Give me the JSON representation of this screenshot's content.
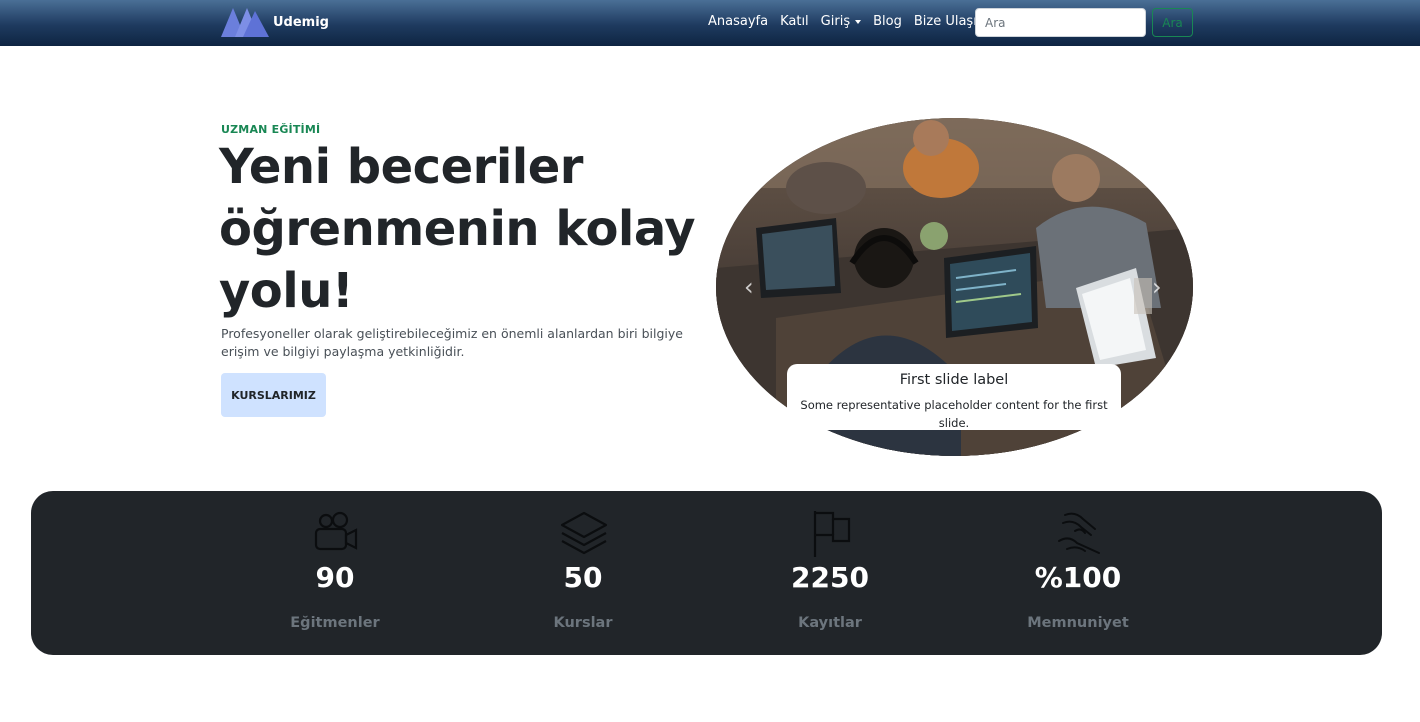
{
  "navbar": {
    "brand": "Udemig",
    "links": [
      "Anasayfa",
      "Katıl",
      "Giriş",
      "Blog",
      "Bize Ulaşın"
    ],
    "search_placeholder": "Ara",
    "search_button": "Ara"
  },
  "hero": {
    "eyebrow": "UZMAN EĞİTİMİ",
    "title": "Yeni beceriler öğrenmenin kolay yolu!",
    "text": "Profesyoneller olarak geliştirebileceğimiz en önemli alanlardan biri bilgiye erişim ve bilgiyi paylaşma yetkinliğidir.",
    "button": "KURSLARIMIZ"
  },
  "carousel": {
    "caption_title": "First slide label",
    "caption_text": "Some representative placeholder content for the first slide."
  },
  "stats": [
    {
      "icon": "video-camera-icon",
      "value": "90",
      "label": "Eğitmenler"
    },
    {
      "icon": "layers-icon",
      "value": "50",
      "label": "Kurslar"
    },
    {
      "icon": "flag-icon",
      "value": "2250",
      "label": "Kayıtlar"
    },
    {
      "icon": "hand-heart-icon",
      "value": "%100",
      "label": "Memnuniyet"
    }
  ],
  "colors": {
    "accent_green": "#198754",
    "stats_bg": "#212529",
    "hero_button_bg": "#cfe2ff",
    "logo_blue": "#6b7fdc"
  }
}
